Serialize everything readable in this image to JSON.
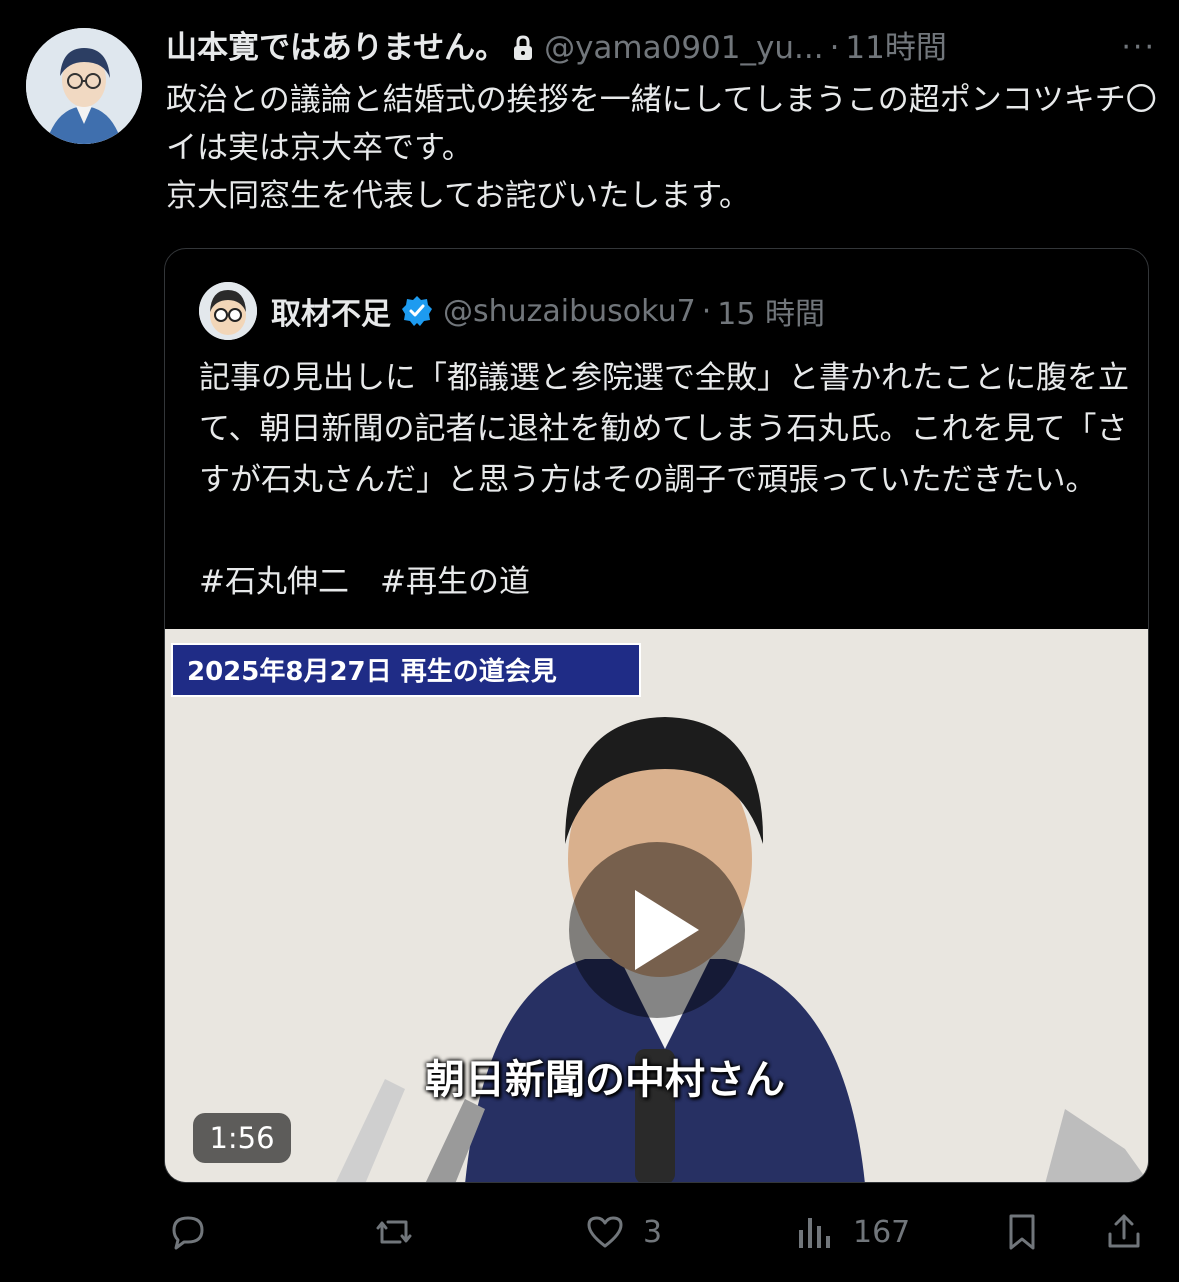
{
  "tweet": {
    "author_name": "山本寛ではありません。",
    "handle": "@yama0901_yu...",
    "separator": "·",
    "time": "11時間",
    "more": "···",
    "text": "政治との議論と結婚式の挨拶を一緒にしてしまうこの超ポンコツキチ〇イは実は京大卒です。\n京大同窓生を代表してお詫びいたします。",
    "icons": {
      "lock": "lock-icon",
      "more": "more-icon"
    }
  },
  "quoted": {
    "author_name": "取材不足",
    "handle": "@shuzaibusoku7",
    "separator": "·",
    "time": "15 時間",
    "text": "記事の見出しに「都議選と参院選で全敗」と書かれたことに腹を立て、朝日新聞の記者に退社を勧めてしまう石丸氏。これを見て「さすが石丸さんだ」と思う方はその調子で頑張っていただきたい。",
    "tags": "#石丸伸二　#再生の道",
    "video": {
      "banner": "2025年8月27日 再生の道会見",
      "caption": "朝日新聞の中村さん",
      "duration": "1:56"
    }
  },
  "actions": {
    "reply_count": "",
    "retweet_count": "",
    "like_count": "3",
    "views_count": "167"
  },
  "colors": {
    "background": "#000000",
    "text": "#e7e9ea",
    "muted": "#71767b",
    "verified": "#1d9bf0",
    "banner": "#1f2c86"
  }
}
